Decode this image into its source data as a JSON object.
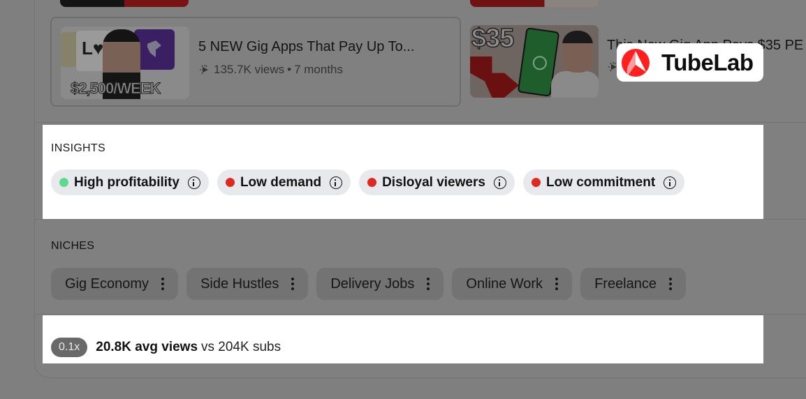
{
  "videos": [
    {
      "title": "5 NEW Gig Apps That Pay Up To...",
      "views": "135.7K views",
      "age": "7 months",
      "thumbnail_caption": "$2,500/WEEK"
    },
    {
      "title": "This New Gig App Pays $35 PE",
      "thumbnail_caption": "$35"
    }
  ],
  "meta_separator": "•",
  "brand": {
    "name": "TubeLab",
    "color": "#ff1f1f"
  },
  "insights": {
    "label": "INSIGHTS",
    "items": [
      {
        "label": "High profitability",
        "status": "positive",
        "color": "#5fd98b"
      },
      {
        "label": "Low demand",
        "status": "negative",
        "color": "#e02a1f"
      },
      {
        "label": "Disloyal viewers",
        "status": "negative",
        "color": "#e02a1f"
      },
      {
        "label": "Low commitment",
        "status": "negative",
        "color": "#e02a1f"
      }
    ]
  },
  "niches": {
    "label": "NICHES",
    "items": [
      "Gig Economy",
      "Side Hustles",
      "Delivery Jobs",
      "Online Work",
      "Freelance"
    ]
  },
  "stats": {
    "ratio": "0.1x",
    "avg_views": "20.8K avg views",
    "subs": "vs 204K subs"
  }
}
